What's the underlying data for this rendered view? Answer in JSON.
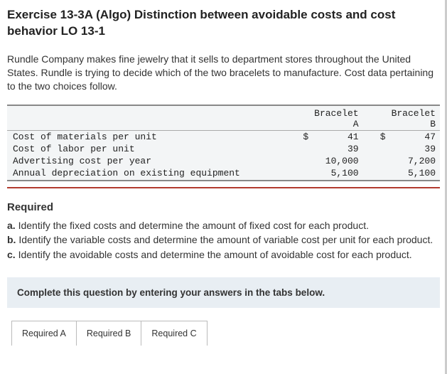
{
  "title": "Exercise 13-3A (Algo) Distinction between avoidable costs and cost behavior LO 13-1",
  "intro": "Rundle Company makes fine jewelry that it sells to department stores throughout the United States. Rundle is trying to decide which of the two bracelets to manufacture. Cost data pertaining to the two choices follow.",
  "table": {
    "colA": "Bracelet A",
    "colB": "Bracelet B",
    "rows": [
      {
        "label": "Cost of materials per unit",
        "curA": "$",
        "valA": "41",
        "curB": "$",
        "valB": "47"
      },
      {
        "label": "Cost of labor per unit",
        "curA": "",
        "valA": "39",
        "curB": "",
        "valB": "39"
      },
      {
        "label": "Advertising cost per year",
        "curA": "",
        "valA": "10,000",
        "curB": "",
        "valB": "7,200"
      },
      {
        "label": "Annual depreciation on existing equipment",
        "curA": "",
        "valA": "5,100",
        "curB": "",
        "valB": "5,100"
      }
    ]
  },
  "required_heading": "Required",
  "required": [
    {
      "letter": "a.",
      "text": " Identify the fixed costs and determine the amount of fixed cost for each product."
    },
    {
      "letter": "b.",
      "text": " Identify the variable costs and determine the amount of variable cost per unit for each product."
    },
    {
      "letter": "c.",
      "text": " Identify the avoidable costs and determine the amount of avoidable cost for each product."
    }
  ],
  "instruction": "Complete this question by entering your answers in the tabs below.",
  "tabs": {
    "a": "Required A",
    "b": "Required B",
    "c": "Required C"
  }
}
